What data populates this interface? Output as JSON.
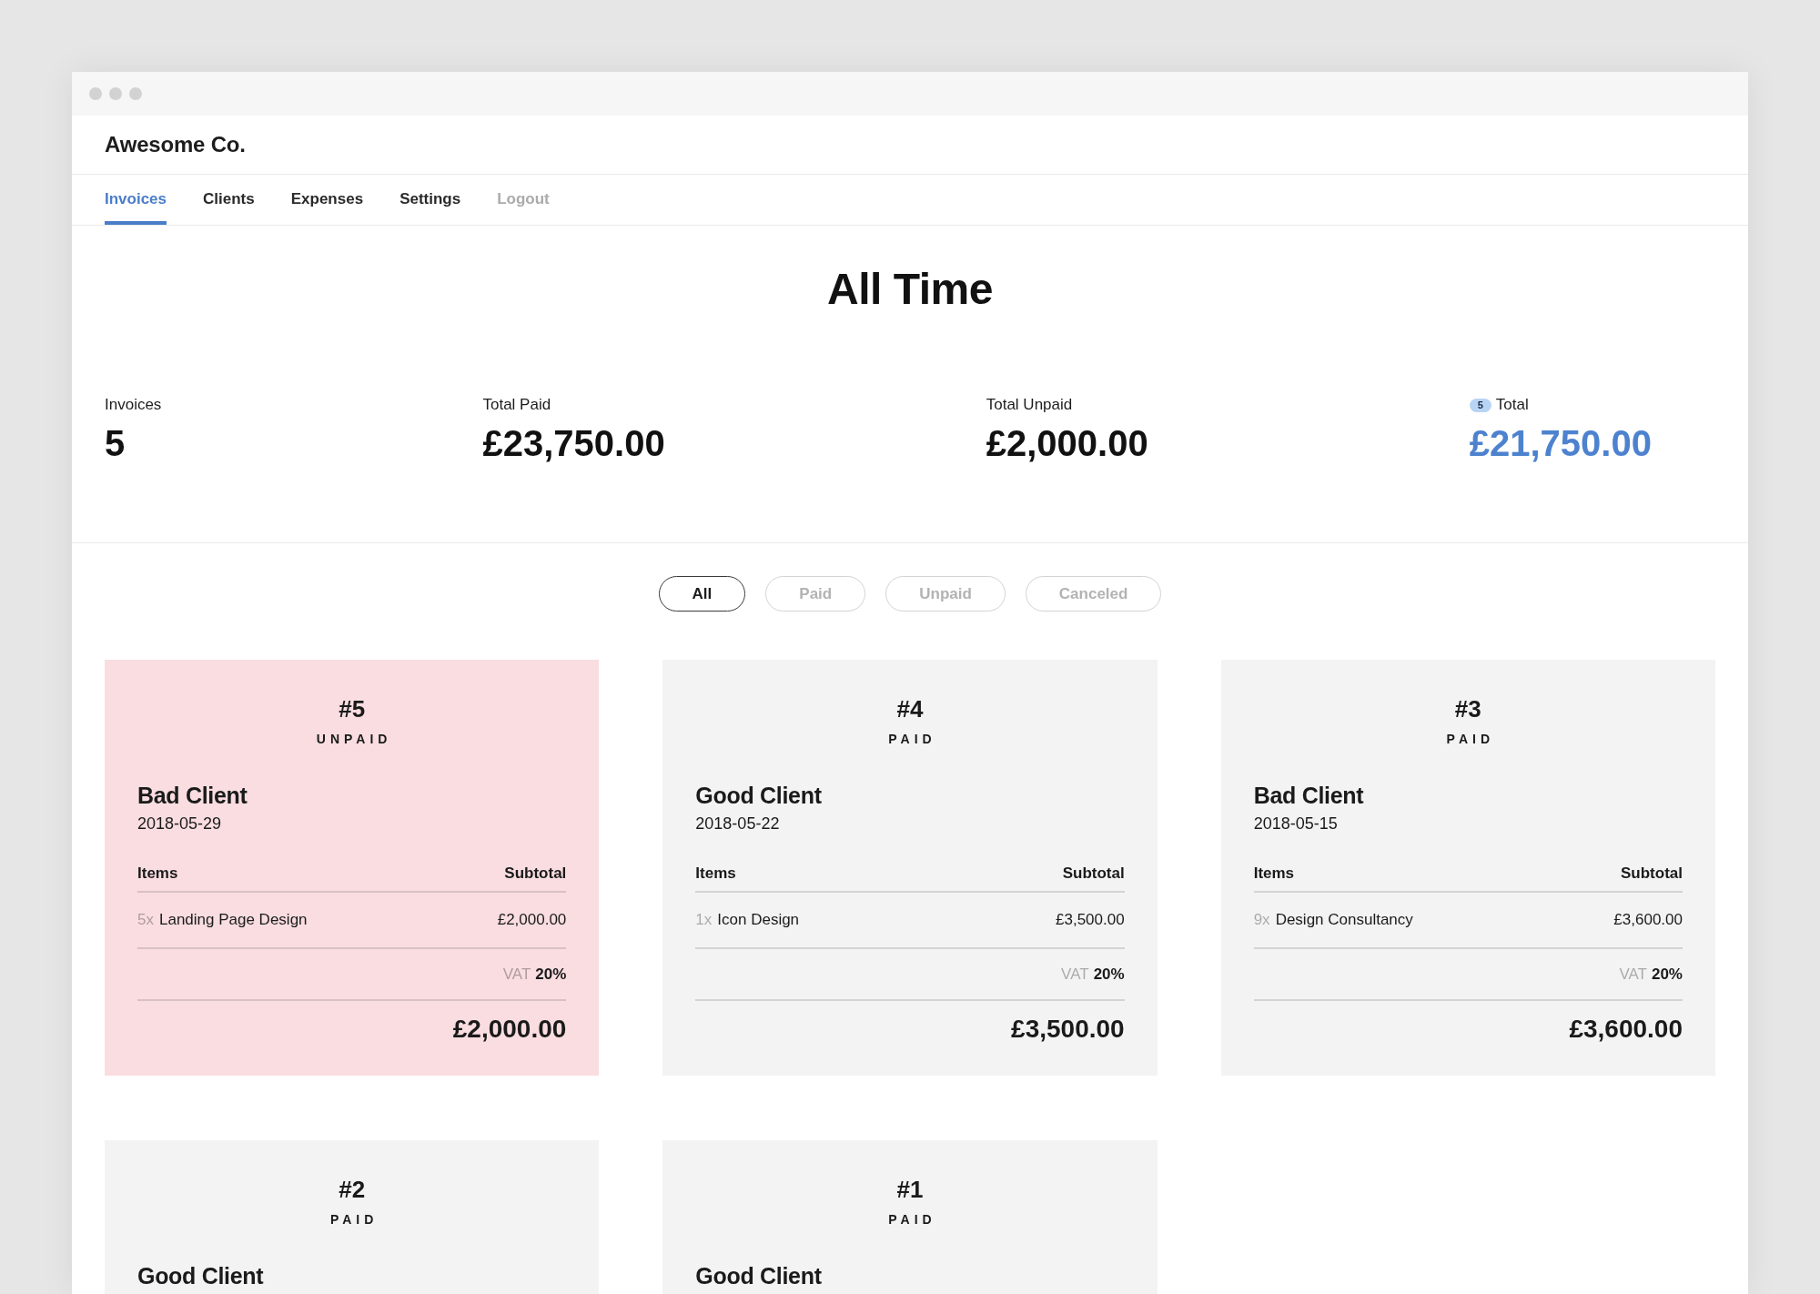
{
  "header": {
    "brand": "Awesome Co."
  },
  "nav": [
    {
      "label": "Invoices",
      "kind": "tab",
      "selected": true
    },
    {
      "label": "Clients",
      "kind": "tab",
      "selected": false
    },
    {
      "label": "Expenses",
      "kind": "tab",
      "selected": false
    },
    {
      "label": "Settings",
      "kind": "tab",
      "selected": false
    },
    {
      "label": "Logout",
      "kind": "action",
      "selected": false
    }
  ],
  "summary": {
    "title": "All Time",
    "stats": [
      {
        "label": "Invoices",
        "value": "5",
        "highlighted": false
      },
      {
        "label": "Total Paid",
        "value": "£23,750.00",
        "highlighted": false
      },
      {
        "label": "Total Unpaid",
        "value": "£2,000.00",
        "highlighted": false
      },
      {
        "badge": "5",
        "label": "Total",
        "value": "£21,750.00",
        "highlighted": true
      }
    ]
  },
  "filters": [
    {
      "label": "All",
      "selected": true
    },
    {
      "label": "Paid",
      "selected": false
    },
    {
      "label": "Unpaid",
      "selected": false
    },
    {
      "label": "Canceled",
      "selected": false
    }
  ],
  "invoices": [
    {
      "number": "#5",
      "status": "UNPAID",
      "paid": false,
      "client": "Bad Client",
      "date": "2018-05-29",
      "columns": [
        "Items",
        "Subtotal"
      ],
      "items": [
        {
          "quantity": "5x",
          "description": "Landing Page Design",
          "subtotal": "£2,000.00"
        }
      ],
      "vat": {
        "label": "VAT",
        "rate": "20%"
      },
      "total": "£2,000.00"
    },
    {
      "number": "#4",
      "status": "PAID",
      "paid": true,
      "client": "Good Client",
      "date": "2018-05-22",
      "columns": [
        "Items",
        "Subtotal"
      ],
      "items": [
        {
          "quantity": "1x",
          "description": "Icon Design",
          "subtotal": "£3,500.00"
        }
      ],
      "vat": {
        "label": "VAT",
        "rate": "20%"
      },
      "total": "£3,500.00"
    },
    {
      "number": "#3",
      "status": "PAID",
      "paid": true,
      "client": "Bad Client",
      "date": "2018-05-15",
      "columns": [
        "Items",
        "Subtotal"
      ],
      "items": [
        {
          "quantity": "9x",
          "description": "Design Consultancy",
          "subtotal": "£3,600.00"
        }
      ],
      "vat": {
        "label": "VAT",
        "rate": "20%"
      },
      "total": "£3,600.00"
    },
    {
      "number": "#2",
      "status": "PAID",
      "paid": true,
      "client": "Good Client"
    },
    {
      "number": "#1",
      "status": "PAID",
      "paid": true,
      "client": "Good Client"
    }
  ]
}
